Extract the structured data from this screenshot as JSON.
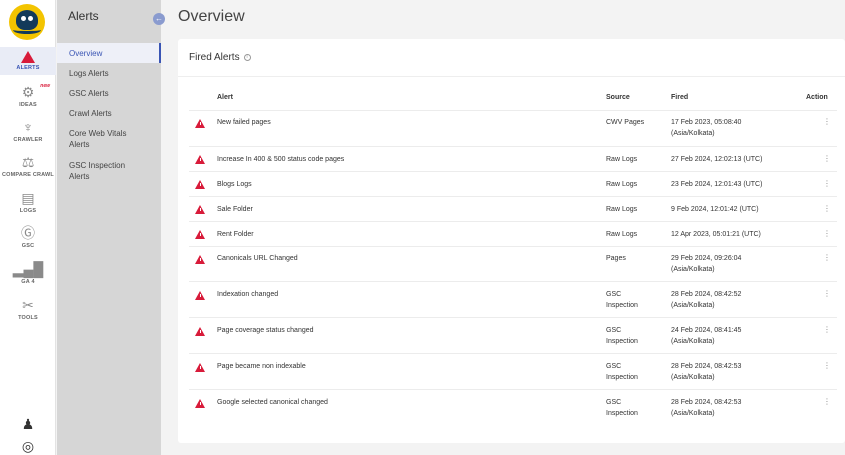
{
  "rail": {
    "items": [
      {
        "label": "ALERTS",
        "icon": "alert-triangle-icon"
      },
      {
        "label": "IDEAS",
        "icon": "lightbulb-icon",
        "badge": "new"
      },
      {
        "label": "CRAWLER",
        "icon": "octopus-icon"
      },
      {
        "label": "COMPARE CRAWL",
        "icon": "scale-icon"
      },
      {
        "label": "LOGS",
        "icon": "document-icon"
      },
      {
        "label": "GSC",
        "icon": "google-icon"
      },
      {
        "label": "GA 4",
        "icon": "bar-chart-icon"
      },
      {
        "label": "TOOLS",
        "icon": "tools-icon"
      }
    ]
  },
  "subnav": {
    "title": "Alerts",
    "items": [
      {
        "label": "Overview"
      },
      {
        "label": "Logs Alerts"
      },
      {
        "label": "GSC Alerts"
      },
      {
        "label": "Crawl Alerts"
      },
      {
        "label": "Core Web Vitals Alerts"
      },
      {
        "label": "GSC Inspection Alerts"
      }
    ]
  },
  "page": {
    "title": "Overview"
  },
  "card": {
    "title": "Fired Alerts"
  },
  "table": {
    "headers": {
      "alert": "Alert",
      "source": "Source",
      "fired": "Fired",
      "action": "Action"
    },
    "rows": [
      {
        "alert": "New failed pages",
        "source": "CWV Pages",
        "fired": "17 Feb 2023, 05:08:40",
        "fired2": "(Asia/Kolkata)",
        "action": "⋮"
      },
      {
        "alert": "Increase In 400 & 500 status code pages",
        "source": "Raw Logs",
        "fired": "27 Feb 2024, 12:02:13 (UTC)",
        "fired2": "",
        "action": "⋮"
      },
      {
        "alert": "Blogs Logs",
        "source": "Raw Logs",
        "fired": "23 Feb 2024, 12:01:43 (UTC)",
        "fired2": "",
        "action": "⋮"
      },
      {
        "alert": "Sale Folder",
        "source": "Raw Logs",
        "fired": "9 Feb 2024, 12:01:42 (UTC)",
        "fired2": "",
        "action": "⋮"
      },
      {
        "alert": "Rent Folder",
        "source": "Raw Logs",
        "fired": "12 Apr 2023, 05:01:21 (UTC)",
        "fired2": "",
        "action": "⋮"
      },
      {
        "alert": "Canonicals URL Changed",
        "source": "Pages",
        "fired": "29 Feb 2024, 09:26:04",
        "fired2": "(Asia/Kolkata)",
        "action": "⋮"
      },
      {
        "alert": "Indexation changed",
        "source": "GSC",
        "source2": "Inspection",
        "fired": "28 Feb 2024, 08:42:52",
        "fired2": "(Asia/Kolkata)",
        "action": "⋮"
      },
      {
        "alert": "Page coverage status changed",
        "source": "GSC",
        "source2": "Inspection",
        "fired": "24 Feb 2024, 08:41:45",
        "fired2": "(Asia/Kolkata)",
        "action": "⋮"
      },
      {
        "alert": "Page became non indexable",
        "source": "GSC",
        "source2": "Inspection",
        "fired": "28 Feb 2024, 08:42:53",
        "fired2": "(Asia/Kolkata)",
        "action": "⋮"
      },
      {
        "alert": "Google selected canonical changed",
        "source": "GSC",
        "source2": "Inspection",
        "fired": "28 Feb 2024, 08:42:53",
        "fired2": "(Asia/Kolkata)",
        "action": "⋮"
      }
    ]
  },
  "colors": {
    "accent": "#3a55b4",
    "alert": "#d81b3a"
  }
}
